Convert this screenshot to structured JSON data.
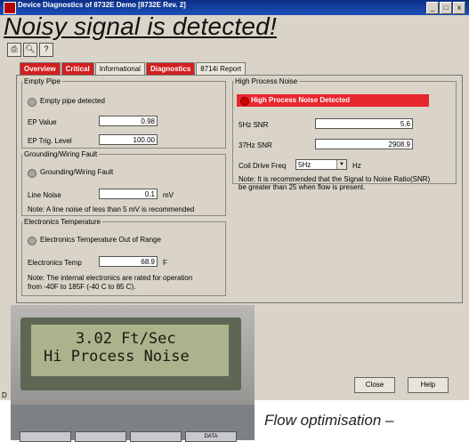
{
  "window": {
    "title": "Device Diagnostics of 8732E Demo [8732E Rev. 2]",
    "controls": [
      "_",
      "□",
      "x"
    ]
  },
  "overlay_title": "Noisy signal is detected!",
  "toolbar": {
    "icons": [
      "print-icon",
      "zoom-icon",
      "help-icon"
    ]
  },
  "tabs": [
    {
      "label": "Overview",
      "alert": true
    },
    {
      "label": "Critical",
      "alert": true
    },
    {
      "label": "Informational",
      "alert": false
    },
    {
      "label": "Diagnostics",
      "alert": true
    },
    {
      "label": "8714i Report",
      "alert": false
    }
  ],
  "empty_pipe": {
    "legend": "Empty Pipe",
    "status_label": "Empty pipe detected",
    "ep_value_label": "EP Value",
    "ep_value": "0.98",
    "ep_trig_label": "EP Trig. Level",
    "ep_trig": "100.00"
  },
  "grounding": {
    "legend": "Grounding/Wiring Fault",
    "status_label": "Grounding/Wiring Fault",
    "line_noise_label": "Line Noise",
    "line_noise": "0.1",
    "line_noise_unit": "mV",
    "note": "Note: A line noise of less than 5 mV is recommended"
  },
  "electronics": {
    "legend": "Electronics Temperature",
    "status_label": "Electronics Temperature Out of Range",
    "temp_label": "Electronics Temp",
    "temp_value": "68.9",
    "temp_unit": "F",
    "note_line1": "Note: The internal electronics are rated for operation",
    "note_line2": "from -40F to 185F (-40 C to 85 C)."
  },
  "high_noise": {
    "legend": "High Process Noise",
    "alarm": "High Process Noise Detected",
    "snr5_label": "5Hz SNR",
    "snr5": "5.6",
    "snr37_label": "37Hz SNR",
    "snr37": "2908.9",
    "coil_label": "Coil Drive Freq",
    "coil_value": "5Hz",
    "coil_unit": "Hz",
    "note_line1": "Note: It is recommended that the Signal to Noise Ratio(SNR)",
    "note_line2": "be greater than 25 when flow is present."
  },
  "buttons": {
    "close": "Close",
    "help": "Help"
  },
  "device_display": {
    "line1": "3.02 Ft/Sec",
    "line2": "Hi Process Noise",
    "key4": "DATA"
  },
  "caption": "Flow optimisation –",
  "status_letter": "D",
  "colors": {
    "alarm": "#e8262e",
    "titlebar": "#0b2e86",
    "window": "#d9d4c7"
  }
}
